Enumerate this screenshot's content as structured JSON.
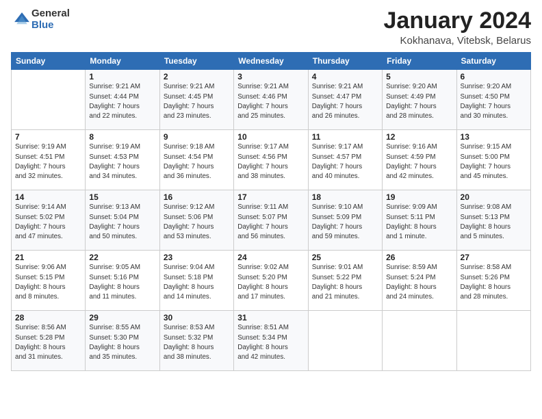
{
  "header": {
    "logo_general": "General",
    "logo_blue": "Blue",
    "month": "January 2024",
    "location": "Kokhanava, Vitebsk, Belarus"
  },
  "days_of_week": [
    "Sunday",
    "Monday",
    "Tuesday",
    "Wednesday",
    "Thursday",
    "Friday",
    "Saturday"
  ],
  "weeks": [
    [
      {
        "day": "",
        "info": ""
      },
      {
        "day": "1",
        "info": "Sunrise: 9:21 AM\nSunset: 4:44 PM\nDaylight: 7 hours\nand 22 minutes."
      },
      {
        "day": "2",
        "info": "Sunrise: 9:21 AM\nSunset: 4:45 PM\nDaylight: 7 hours\nand 23 minutes."
      },
      {
        "day": "3",
        "info": "Sunrise: 9:21 AM\nSunset: 4:46 PM\nDaylight: 7 hours\nand 25 minutes."
      },
      {
        "day": "4",
        "info": "Sunrise: 9:21 AM\nSunset: 4:47 PM\nDaylight: 7 hours\nand 26 minutes."
      },
      {
        "day": "5",
        "info": "Sunrise: 9:20 AM\nSunset: 4:49 PM\nDaylight: 7 hours\nand 28 minutes."
      },
      {
        "day": "6",
        "info": "Sunrise: 9:20 AM\nSunset: 4:50 PM\nDaylight: 7 hours\nand 30 minutes."
      }
    ],
    [
      {
        "day": "7",
        "info": "Sunrise: 9:19 AM\nSunset: 4:51 PM\nDaylight: 7 hours\nand 32 minutes."
      },
      {
        "day": "8",
        "info": "Sunrise: 9:19 AM\nSunset: 4:53 PM\nDaylight: 7 hours\nand 34 minutes."
      },
      {
        "day": "9",
        "info": "Sunrise: 9:18 AM\nSunset: 4:54 PM\nDaylight: 7 hours\nand 36 minutes."
      },
      {
        "day": "10",
        "info": "Sunrise: 9:17 AM\nSunset: 4:56 PM\nDaylight: 7 hours\nand 38 minutes."
      },
      {
        "day": "11",
        "info": "Sunrise: 9:17 AM\nSunset: 4:57 PM\nDaylight: 7 hours\nand 40 minutes."
      },
      {
        "day": "12",
        "info": "Sunrise: 9:16 AM\nSunset: 4:59 PM\nDaylight: 7 hours\nand 42 minutes."
      },
      {
        "day": "13",
        "info": "Sunrise: 9:15 AM\nSunset: 5:00 PM\nDaylight: 7 hours\nand 45 minutes."
      }
    ],
    [
      {
        "day": "14",
        "info": "Sunrise: 9:14 AM\nSunset: 5:02 PM\nDaylight: 7 hours\nand 47 minutes."
      },
      {
        "day": "15",
        "info": "Sunrise: 9:13 AM\nSunset: 5:04 PM\nDaylight: 7 hours\nand 50 minutes."
      },
      {
        "day": "16",
        "info": "Sunrise: 9:12 AM\nSunset: 5:06 PM\nDaylight: 7 hours\nand 53 minutes."
      },
      {
        "day": "17",
        "info": "Sunrise: 9:11 AM\nSunset: 5:07 PM\nDaylight: 7 hours\nand 56 minutes."
      },
      {
        "day": "18",
        "info": "Sunrise: 9:10 AM\nSunset: 5:09 PM\nDaylight: 7 hours\nand 59 minutes."
      },
      {
        "day": "19",
        "info": "Sunrise: 9:09 AM\nSunset: 5:11 PM\nDaylight: 8 hours\nand 1 minute."
      },
      {
        "day": "20",
        "info": "Sunrise: 9:08 AM\nSunset: 5:13 PM\nDaylight: 8 hours\nand 5 minutes."
      }
    ],
    [
      {
        "day": "21",
        "info": "Sunrise: 9:06 AM\nSunset: 5:15 PM\nDaylight: 8 hours\nand 8 minutes."
      },
      {
        "day": "22",
        "info": "Sunrise: 9:05 AM\nSunset: 5:16 PM\nDaylight: 8 hours\nand 11 minutes."
      },
      {
        "day": "23",
        "info": "Sunrise: 9:04 AM\nSunset: 5:18 PM\nDaylight: 8 hours\nand 14 minutes."
      },
      {
        "day": "24",
        "info": "Sunrise: 9:02 AM\nSunset: 5:20 PM\nDaylight: 8 hours\nand 17 minutes."
      },
      {
        "day": "25",
        "info": "Sunrise: 9:01 AM\nSunset: 5:22 PM\nDaylight: 8 hours\nand 21 minutes."
      },
      {
        "day": "26",
        "info": "Sunrise: 8:59 AM\nSunset: 5:24 PM\nDaylight: 8 hours\nand 24 minutes."
      },
      {
        "day": "27",
        "info": "Sunrise: 8:58 AM\nSunset: 5:26 PM\nDaylight: 8 hours\nand 28 minutes."
      }
    ],
    [
      {
        "day": "28",
        "info": "Sunrise: 8:56 AM\nSunset: 5:28 PM\nDaylight: 8 hours\nand 31 minutes."
      },
      {
        "day": "29",
        "info": "Sunrise: 8:55 AM\nSunset: 5:30 PM\nDaylight: 8 hours\nand 35 minutes."
      },
      {
        "day": "30",
        "info": "Sunrise: 8:53 AM\nSunset: 5:32 PM\nDaylight: 8 hours\nand 38 minutes."
      },
      {
        "day": "31",
        "info": "Sunrise: 8:51 AM\nSunset: 5:34 PM\nDaylight: 8 hours\nand 42 minutes."
      },
      {
        "day": "",
        "info": ""
      },
      {
        "day": "",
        "info": ""
      },
      {
        "day": "",
        "info": ""
      }
    ]
  ]
}
